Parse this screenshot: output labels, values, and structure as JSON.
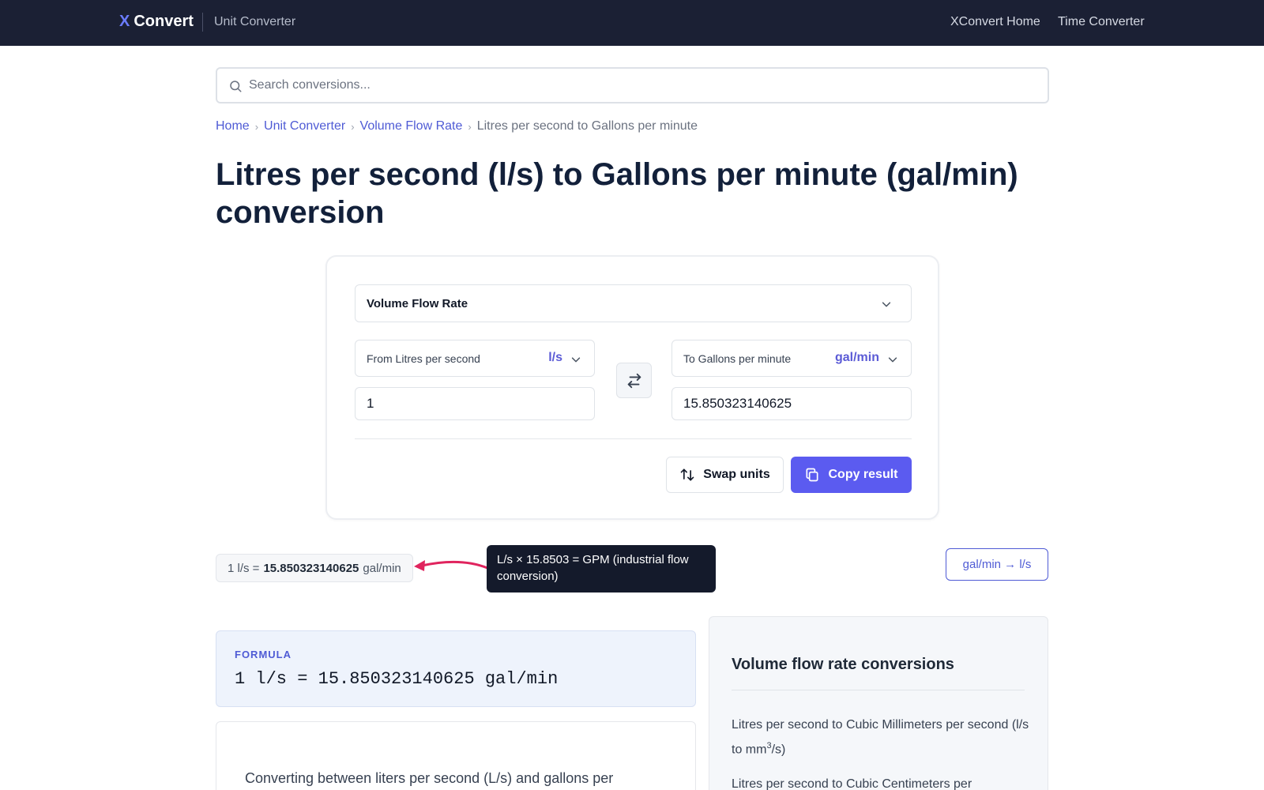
{
  "nav": {
    "brand_x": "X",
    "brand_name": "Convert",
    "brand_sub": "Unit Converter",
    "links": [
      "XConvert Home",
      "Time Converter"
    ]
  },
  "search": {
    "placeholder": "Search conversions..."
  },
  "breadcrumb": {
    "items": [
      "Home",
      "Unit Converter",
      "Volume Flow Rate"
    ],
    "separator": "›",
    "current": "Litres per second to Gallons per minute"
  },
  "page_title": "Litres per second (l/s) to Gallons per minute (gal/min) conversion",
  "converter": {
    "category": "Volume Flow Rate",
    "from": {
      "label": "From Litres per second",
      "abbr": "l/s",
      "value": "1"
    },
    "to": {
      "label": "To Gallons per minute",
      "abbr": "gal/min",
      "value": "15.850323140625"
    },
    "swap_label": "Swap units",
    "copy_label": "Copy result"
  },
  "result": {
    "prefix": "1 l/s =",
    "value": "15.850323140625",
    "suffix": "gal/min"
  },
  "tooltip": "L/s × 15.8503 = GPM (industrial flow conversion)",
  "reverse_link": "gal/min → l/s",
  "formula": {
    "label": "FORMULA",
    "text": "1 l/s = 15.850323140625 gal/min"
  },
  "description": "Converting between liters per second (L/s) and gallons per",
  "sidebar": {
    "title": "Volume flow rate conversions",
    "link1_main": "Litres per second to Cubic Millimeters per second (l/s to mm",
    "link1_sup": "3",
    "link1_end": "/s)",
    "link2": "Litres per second to Cubic Centimeters per"
  },
  "colors": {
    "nav_bg": "#1b2034",
    "accent": "#5b5bf0",
    "link": "#4f5bd5",
    "tooltip_bg": "#141a2b",
    "arrow": "#e0245e"
  }
}
